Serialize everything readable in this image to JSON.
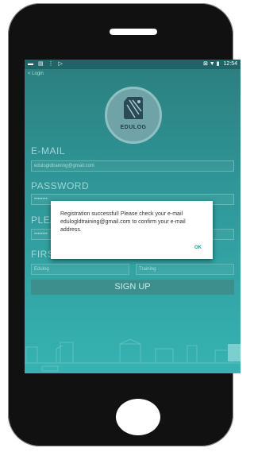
{
  "statusbar": {
    "left_icons": "▬ ▤ ⋮ ▷",
    "right_icons": "⊠ ▼ ▮",
    "time": "12:54"
  },
  "back_link": "< Login",
  "logo": {
    "text": "EDULOG"
  },
  "form": {
    "email_label": "E-MAIL",
    "email_value": "edulogldtraining@gmail.com",
    "password_label": "PASSWORD",
    "password_value": "••••••••",
    "confirm_label": "PLEA",
    "confirm_value": "••••••••",
    "firstname_label": "FIRS",
    "firstname_value": "Edulog",
    "lastname_value": "Training",
    "signup_label": "SIGN UP"
  },
  "dialog": {
    "message": "Registration successful! Please check your e-mail edulogldtraining@gmail.com to confirm your e-mail address.",
    "ok_label": "OK"
  },
  "colors": {
    "screen_top": "#2c7e7e",
    "screen_bottom": "#36b3b2",
    "accent": "#2a9a96"
  }
}
